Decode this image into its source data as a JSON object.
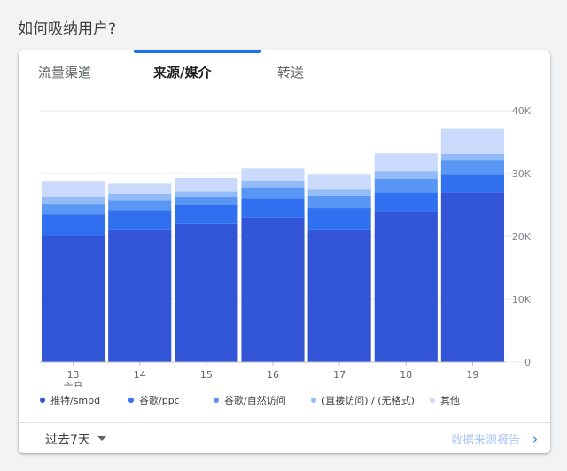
{
  "page": {
    "title": "如何吸纳用户?"
  },
  "tabs": [
    {
      "label": "流量渠道",
      "active": false
    },
    {
      "label": "来源/媒介",
      "active": true
    },
    {
      "label": "转送",
      "active": false
    }
  ],
  "footer": {
    "range_label": "过去7天",
    "report_link": "数据来源报告",
    "chevron": "›"
  },
  "colors": {
    "accent": "#1a73e8",
    "series": [
      "#3254d6",
      "#2f6ff0",
      "#5a97f5",
      "#92bbf8",
      "#c9dafc"
    ]
  },
  "chart_data": {
    "type": "bar",
    "stacked": true,
    "categories": [
      "13",
      "14",
      "15",
      "16",
      "17",
      "18",
      "19"
    ],
    "x_sublabel": "六月",
    "series": [
      {
        "name": "推特/smpd",
        "values": [
          20000,
          21000,
          22000,
          23000,
          21000,
          24000,
          27000
        ]
      },
      {
        "name": "谷歌/ppc",
        "values": [
          3500,
          3200,
          3000,
          3000,
          3500,
          3000,
          2800
        ]
      },
      {
        "name": "谷歌/自然访问",
        "values": [
          1700,
          1500,
          1200,
          1800,
          2000,
          2200,
          2300
        ]
      },
      {
        "name": "(直接访问) / (无格式)",
        "values": [
          1000,
          1100,
          900,
          1000,
          900,
          1200,
          1000
        ]
      },
      {
        "name": "其他",
        "values": [
          2500,
          1600,
          2200,
          2000,
          2400,
          2800,
          4000
        ]
      }
    ],
    "ylim": [
      0,
      40000
    ],
    "yticks": [
      "0",
      "10K",
      "20K",
      "30K",
      "40K"
    ],
    "y_axis_side": "right",
    "grid": true,
    "legend_position": "bottom"
  }
}
